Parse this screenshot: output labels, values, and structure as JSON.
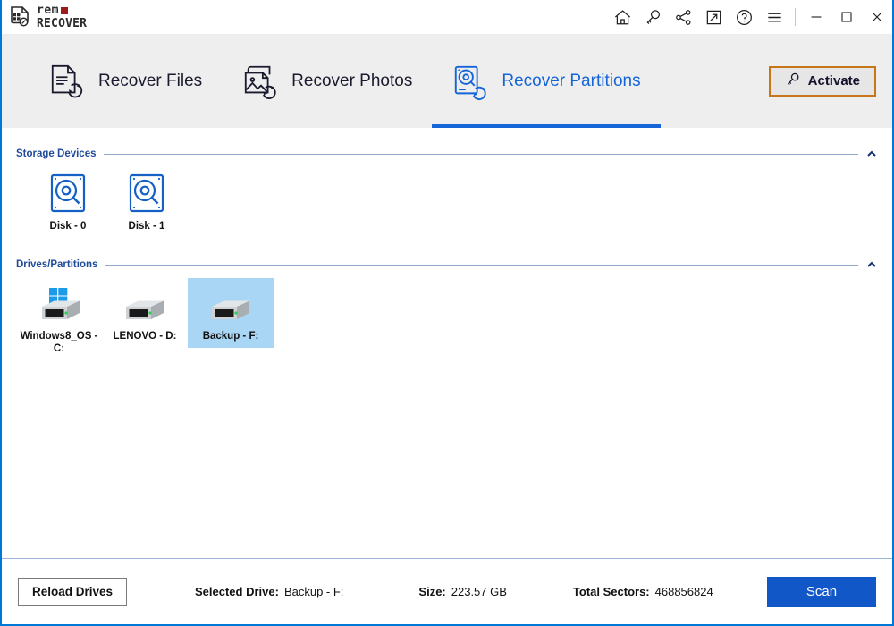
{
  "window": {
    "logo_line1": "rem",
    "logo_line2": "RECOVER",
    "accent_blue": "#1565d8",
    "border_blue": "#0078d7"
  },
  "titlebar": {
    "actions": [
      {
        "name": "home-icon",
        "label": "Home"
      },
      {
        "name": "key-icon",
        "label": "Activate"
      },
      {
        "name": "share-icon",
        "label": "Share"
      },
      {
        "name": "external-link-icon",
        "label": "Open External"
      },
      {
        "name": "help-icon",
        "label": "Help"
      },
      {
        "name": "hamburger-menu-icon",
        "label": "Menu"
      }
    ],
    "window_controls": [
      {
        "name": "minimize-button",
        "label": "Minimize"
      },
      {
        "name": "maximize-button",
        "label": "Maximize"
      },
      {
        "name": "close-button",
        "label": "Close"
      }
    ]
  },
  "tabs": [
    {
      "label": "Recover Files",
      "icon": "recover-files-icon",
      "active": false
    },
    {
      "label": "Recover Photos",
      "icon": "recover-photos-icon",
      "active": false
    },
    {
      "label": "Recover Partitions",
      "icon": "recover-partitions-icon",
      "active": true
    }
  ],
  "activate": {
    "label": "Activate",
    "icon": "key-icon",
    "border_color": "#c8761a"
  },
  "sections": {
    "storage_devices": {
      "title": "Storage Devices",
      "collapse_icon": "chevron-up-icon",
      "items": [
        {
          "label": "Disk - 0",
          "icon": "disk-search-icon"
        },
        {
          "label": "Disk - 1",
          "icon": "disk-search-icon"
        }
      ]
    },
    "drives_partitions": {
      "title": "Drives/Partitions",
      "collapse_icon": "chevron-up-icon",
      "items": [
        {
          "label": "Windows8_OS - C:",
          "icon": "windows-drive-icon",
          "selected": false
        },
        {
          "label": "LENOVO - D:",
          "icon": "drive-icon",
          "selected": false
        },
        {
          "label": "Backup - F:",
          "icon": "drive-icon",
          "selected": true
        }
      ]
    }
  },
  "footer": {
    "reload_label": "Reload Drives",
    "selected_drive_key": "Selected Drive:",
    "selected_drive_value": "Backup - F:",
    "size_key": "Size:",
    "size_value": "223.57 GB",
    "sectors_key": "Total Sectors:",
    "sectors_value": "468856824",
    "scan_label": "Scan",
    "scan_color": "#1257c8"
  }
}
